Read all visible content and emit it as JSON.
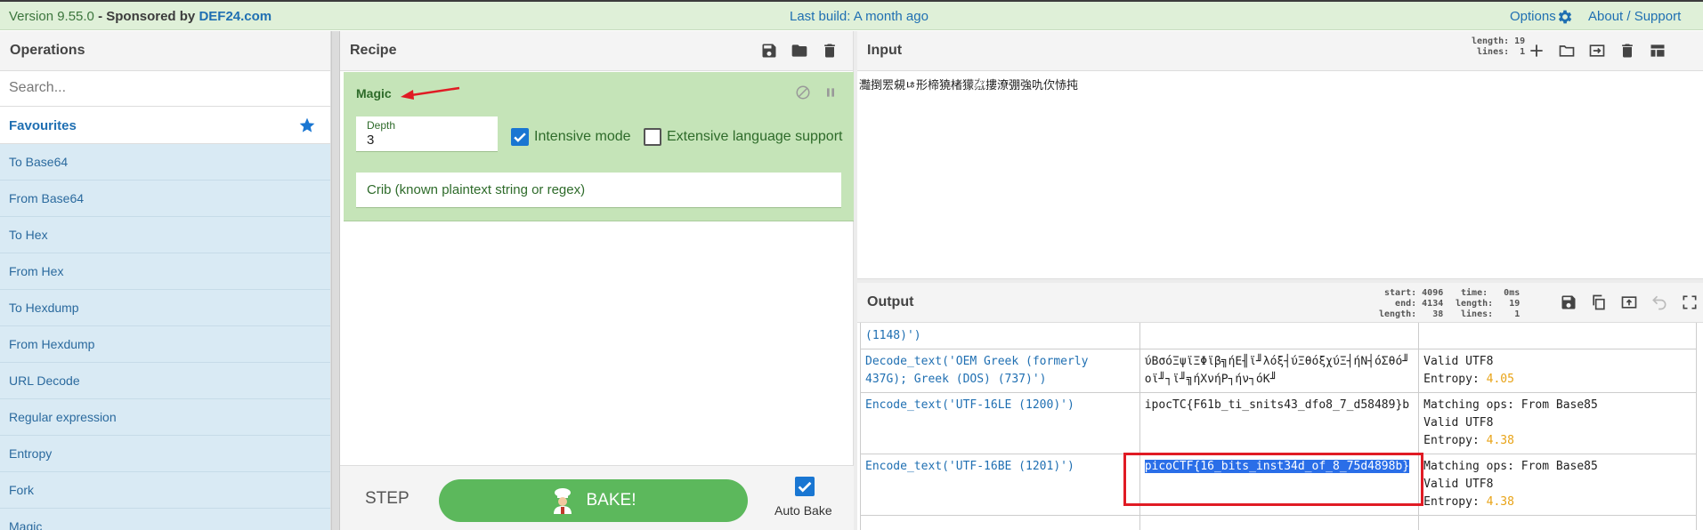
{
  "banner": {
    "version": "Version 9.55.0",
    "sponsor": "- Sponsored by",
    "sponsor_name": "DEF24.com",
    "last_build": "Last build: A month ago",
    "options": "Options",
    "about": "About / Support"
  },
  "operations": {
    "title": "Operations",
    "search_placeholder": "Search...",
    "favourites": "Favourites",
    "items": [
      {
        "label": "To Base64"
      },
      {
        "label": "From Base64"
      },
      {
        "label": "To Hex"
      },
      {
        "label": "From Hex"
      },
      {
        "label": "To Hexdump"
      },
      {
        "label": "From Hexdump"
      },
      {
        "label": "URL Decode"
      },
      {
        "label": "Regular expression"
      },
      {
        "label": "Entropy"
      },
      {
        "label": "Fork"
      },
      {
        "label": "Magic"
      }
    ]
  },
  "recipe": {
    "title": "Recipe",
    "magic": {
      "title": "Magic",
      "depth_label": "Depth",
      "depth_value": "3",
      "intensive_label": "Intensive mode",
      "intensive_checked": true,
      "extensive_label": "Extensive language support",
      "extensive_checked": false,
      "crib_placeholder": "Crib (known plaintext string or regex)"
    },
    "step": "STEP",
    "bake": "BAKE!",
    "auto_bake": "Auto Bake",
    "auto_bake_checked": true
  },
  "input": {
    "title": "Input",
    "stats": "length: 19\n lines:  1",
    "text": "灩捯䍔䙻ㄶ形楴獟楮獴㌴摟潦弸強㕤㐸㤸扽"
  },
  "output": {
    "title": "Output",
    "stats_a": "start: 4096\n  end: 4134\nlength:   38",
    "stats_b": "time:   0ms\nlength:   19\n lines:    1",
    "rows": [
      {
        "op": "(1148)')",
        "result": "",
        "props": ""
      },
      {
        "op": "Decode_text('OEM Greek (formerly 437G); Greek (DOS) (737)')",
        "result": "ύΒσόΞψϊΞΦϊβ╗ήΕ╢ϊ╜λόξ┤ύΞθόξχύΞ┤ήΝ┤όΣθό╜οϊ╜┐ϊ╜╗ήΧνήΡ┐ήν┐όΚ╜",
        "props": "Valid UTF8",
        "entropy_label": "Entropy: ",
        "entropy": "4.05"
      },
      {
        "op": "Encode_text('UTF-16LE (1200)')",
        "result": "ipocTC{F61b_ti_snits43_dfo8_7_d58489}b",
        "props": "Matching ops: From Base85\nValid UTF8",
        "entropy_label": "Entropy: ",
        "entropy": "4.38"
      },
      {
        "op": "Encode_text('UTF-16BE (1201)')",
        "result": "picoCTF{16_bits_inst34d_of_8_75d4898b}",
        "props": "Matching ops: From Base85\nValid UTF8",
        "entropy_label": "Entropy: ",
        "entropy": "4.38"
      }
    ]
  }
}
